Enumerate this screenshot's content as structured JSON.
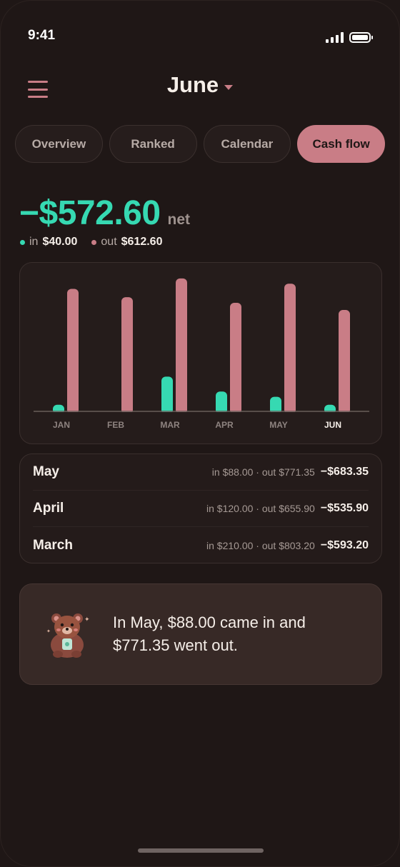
{
  "status_bar": {
    "time": "9:41",
    "battery_level": 1.0
  },
  "header": {
    "month": "June",
    "menu_icon": "hamburger-icon",
    "dropdown_icon": "caret-down-icon"
  },
  "tabs": [
    {
      "label": "Overview",
      "active": false
    },
    {
      "label": "Ranked",
      "active": false
    },
    {
      "label": "Calendar",
      "active": false
    },
    {
      "label": "Cash flow",
      "active": true
    }
  ],
  "summary": {
    "net": "−$572.60",
    "net_label": "net",
    "in_label": "in",
    "in_value": "$40.00",
    "out_label": "out",
    "out_value": "$612.60"
  },
  "colors": {
    "in": "#36d9b2",
    "out": "#c97d86",
    "background": "#1f1716"
  },
  "chart_data": {
    "type": "bar",
    "categories": [
      "JAN",
      "FEB",
      "MAR",
      "APR",
      "MAY",
      "JUN"
    ],
    "highlighted_category": "JUN",
    "series": [
      {
        "name": "in",
        "color": "#36d9b2",
        "values": [
          40,
          0,
          210,
          120,
          88,
          40
        ]
      },
      {
        "name": "out",
        "color": "#c97d86",
        "values": [
          740,
          690,
          803.2,
          655.9,
          771.35,
          612.6
        ]
      }
    ],
    "ylim": [
      0,
      820
    ],
    "grid": false
  },
  "history": [
    {
      "month": "May",
      "detail": "in $88.00 · out $771.35",
      "net": "−$683.35"
    },
    {
      "month": "April",
      "detail": "in $120.00 · out $655.90",
      "net": "−$535.90"
    },
    {
      "month": "March",
      "detail": "in $210.00 · out $803.20",
      "net": "−$593.20"
    }
  ],
  "insight": {
    "icon": "bear-mascot-icon",
    "text": "In May, $88.00 came in and $771.35 went out."
  }
}
